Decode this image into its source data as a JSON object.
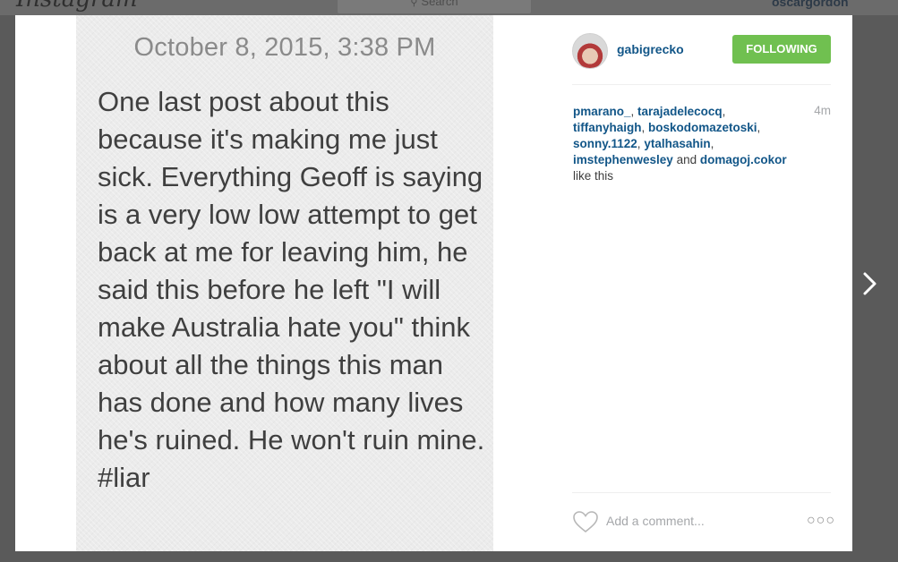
{
  "app": {
    "logo": "Instagram",
    "search_placeholder": "Search",
    "current_user": "oscargordon"
  },
  "post": {
    "photo": {
      "date": "October 8, 2015, 3:38 PM",
      "text": "One last post about this because it's making me just sick. Everything Geoff is saying is a very low low attempt to get back at me for leaving him, he said this before he left \"I will make Australia hate you\" think about all the things this man has done and how many lives he's ruined. He won't ruin mine. #liar"
    },
    "author": {
      "username": "gabigrecko",
      "follow_label": "FOLLOWING"
    },
    "time_ago": "4m",
    "likes": {
      "users": [
        "pmarano_",
        "tarajadelecocq",
        "tiffanyhaigh",
        "boskodomazetoski",
        "sonny.1122",
        "ytalhasahin",
        "imstephenwesley",
        "domagoj.cokor"
      ],
      "connector": "and",
      "suffix": "like this"
    },
    "comment_placeholder": "Add a comment...",
    "more_label": "○○○"
  },
  "colors": {
    "link": "#125688",
    "follow_button": "#70c050",
    "overlay": "#5a5a5a"
  },
  "icons": {
    "heart": "heart-icon",
    "next": "chevron-right-icon",
    "search": "search-icon",
    "more": "more-options-icon"
  }
}
